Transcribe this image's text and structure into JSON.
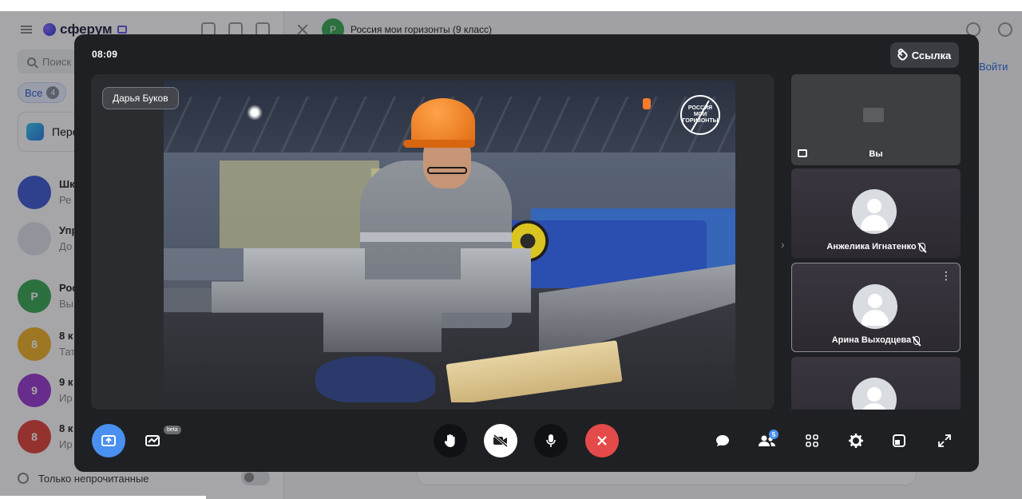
{
  "background_app": {
    "logo_text": "сферум",
    "search_placeholder": "Поиск",
    "filter_all_label": "Все",
    "filter_all_count": "4",
    "pinned_label": "Пере",
    "chats": [
      {
        "initial": "",
        "title": "Шк",
        "preview": "Ре",
        "color": "#3f5bd1"
      },
      {
        "initial": "",
        "title": "Упр",
        "preview": "До",
        "color": "#dfe3ea"
      },
      {
        "initial": "Р",
        "title": "Рос",
        "preview": "Вы",
        "color": "#3aa856"
      },
      {
        "initial": "8",
        "title": "8 к",
        "preview": "Тат",
        "color": "#f0b429"
      },
      {
        "initial": "9",
        "title": "9 к",
        "preview": "Ир",
        "color": "#9b3ad1"
      },
      {
        "initial": "8",
        "title": "8 к",
        "preview": "Ир",
        "color": "#e0443a"
      }
    ],
    "unread_only_label": "Только непрочитанные",
    "chat_header": {
      "avatar_initial": "Р",
      "title": "Россия мои горизонты (9 класс)"
    },
    "join_label": "Войти"
  },
  "call": {
    "timer": "08:09",
    "link_button_label": "Ссылка",
    "speaker_name": "Дарья Буков",
    "watermark_text": "РОССИЯ МОИ ГОРИЗОНТЫ",
    "participants": [
      {
        "name": "Вы",
        "type": "screen-share",
        "muted": false
      },
      {
        "name": "Анжелика Игнатенко",
        "type": "avatar",
        "muted": true
      },
      {
        "name": "Арина Выходцева",
        "type": "avatar",
        "muted": true,
        "active": true
      },
      {
        "name": "",
        "type": "avatar",
        "muted": false
      }
    ],
    "controls": {
      "beta_label": "beta",
      "participants_count": "5",
      "left": [
        {
          "id": "screen-share",
          "icon": "screen-share-icon"
        },
        {
          "id": "whiteboard",
          "icon": "whiteboard-icon"
        }
      ],
      "center": [
        {
          "id": "raise-hand",
          "icon": "hand-icon"
        },
        {
          "id": "camera",
          "icon": "camera-off-icon"
        },
        {
          "id": "microphone",
          "icon": "microphone-icon"
        },
        {
          "id": "end-call",
          "icon": "close-icon"
        }
      ],
      "right": [
        {
          "id": "chat",
          "icon": "chat-icon"
        },
        {
          "id": "participants",
          "icon": "participants-icon"
        },
        {
          "id": "grid",
          "icon": "grid-icon"
        },
        {
          "id": "settings",
          "icon": "gear-icon"
        },
        {
          "id": "layout",
          "icon": "layout-icon"
        },
        {
          "id": "fullscreen",
          "icon": "expand-icon"
        }
      ]
    },
    "colors": {
      "accent": "#4a90f0",
      "end_call": "#e54a4a",
      "modal_bg": "#1f2023"
    }
  }
}
